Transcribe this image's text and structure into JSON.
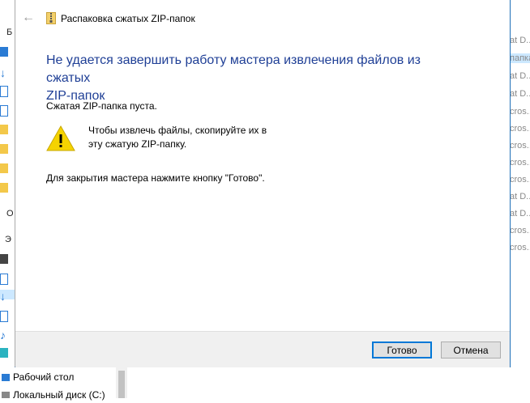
{
  "background": {
    "left_fragments": [
      "Б",
      "О",
      "Э"
    ],
    "right_rows": [
      "at D...",
      "папка",
      "at D...",
      "at D...",
      "cros...",
      "cros...",
      "cros...",
      "cros...",
      "cros...",
      "at D...",
      "at D...",
      "cros...",
      "cros..."
    ],
    "nav": {
      "desktop_label": "Рабочий стол",
      "disk_label": "Локальный диск (C:)"
    }
  },
  "dialog": {
    "title": "Распаковка сжатых ZIP-папок",
    "heading_line1": "Не удается завершить работу мастера извлечения файлов из сжатых",
    "heading_line2": "ZIP-папок",
    "empty_message": "Сжатая ZIP-папка пуста.",
    "warning_line1": "Чтобы извлечь файлы, скопируйте их в",
    "warning_line2": "эту сжатую ZIP-папку.",
    "close_hint": "Для закрытия мастера нажмите кнопку \"Готово\".",
    "buttons": {
      "done": "Готово",
      "cancel": "Отмена"
    }
  },
  "colors": {
    "heading": "#1f3f96",
    "accent": "#0078d7",
    "warning_yellow": "#f5d300"
  }
}
